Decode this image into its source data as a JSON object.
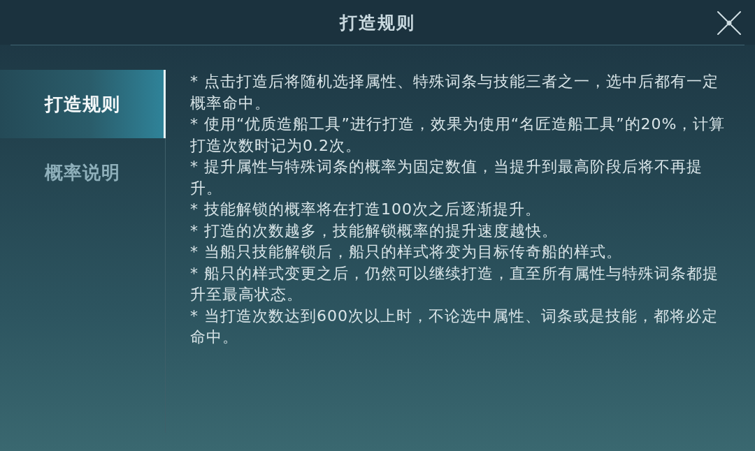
{
  "window": {
    "title": "打造规则"
  },
  "tabs": [
    {
      "label": "打造规则",
      "selected": true
    },
    {
      "label": "概率说明",
      "selected": false
    }
  ],
  "rules": [
    "* 点击打造后将随机选择属性、特殊词条与技能三者之一，选中后都有一定概率命中。",
    "* 使用“优质造船工具”进行打造，效果为使用“名匠造船工具”的20%，计算打造次数时记为0.2次。",
    "* 提升属性与特殊词条的概率为固定数值，当提升到最高阶段后将不再提升。",
    "* 技能解锁的概率将在打造100次之后逐渐提升。",
    "* 打造的次数越多，技能解锁概率的提升速度越快。",
    "* 当船只技能解锁后，船只的样式将变为目标传奇船的样式。",
    "* 船只的样式变更之后，仍然可以继续打造，直至所有属性与特殊词条都提升至最高状态。",
    "* 当打造次数达到600次以上时，不论选中属性、词条或是技能，都将必定命中。"
  ]
}
